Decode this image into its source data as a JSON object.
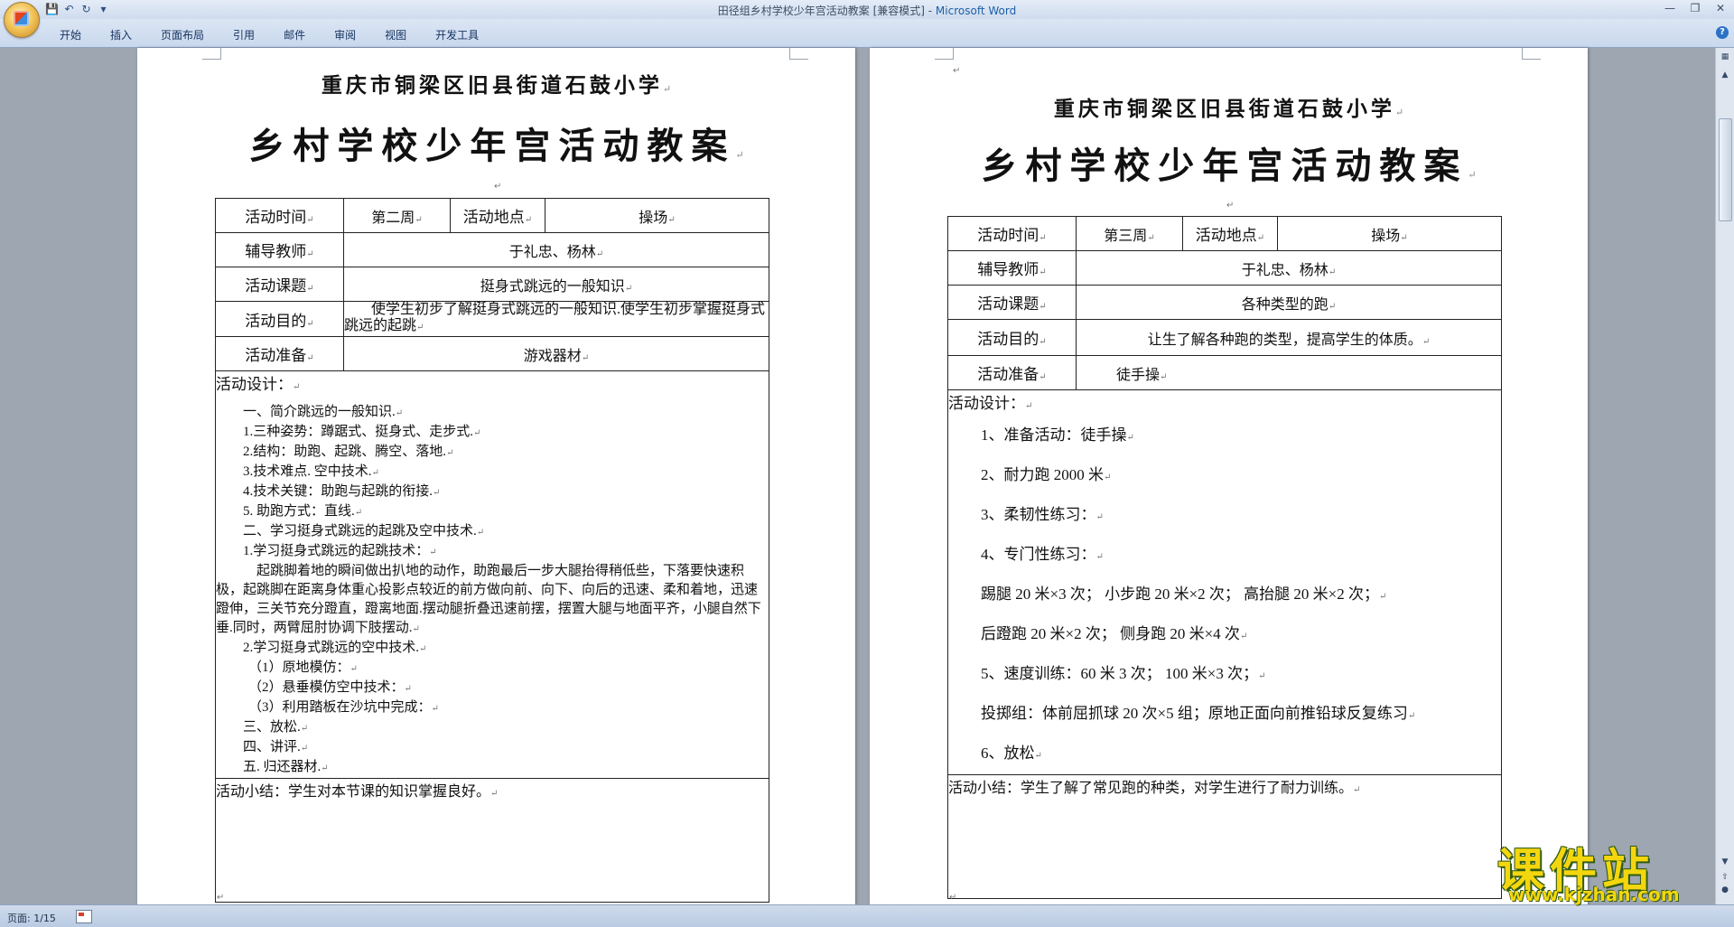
{
  "window": {
    "title_doc": "田径组乡村学校少年宫活动教案 [兼容模式] - ",
    "title_app": "Microsoft Word"
  },
  "ribbon": {
    "tabs": [
      "开始",
      "插入",
      "页面布局",
      "引用",
      "邮件",
      "审阅",
      "视图",
      "开发工具"
    ]
  },
  "status": {
    "page": "页面: 1/15"
  },
  "pages": [
    {
      "school": "重庆市铜梁区旧县街道石鼓小学",
      "title": "乡村学校少年宫活动教案",
      "labels": {
        "time": "活动时间",
        "place": "活动地点",
        "teacher": "辅导教师",
        "topic": "活动课题",
        "purpose": "活动目的",
        "prep": "活动准备",
        "design": "活动设计：",
        "summary_label": "活动小结："
      },
      "time": "第二周",
      "place": "操场",
      "teacher": "于礼忠、杨林",
      "topic": "挺身式跳远的一般知识",
      "purpose": "使学生初步了解挺身式跳远的一般知识.使学生初步掌握挺身式跳远的起跳",
      "prep": "游戏器材",
      "design_lines": [
        "一、简介跳远的一般知识.",
        "1.三种姿势：蹲踞式、挺身式、走步式.",
        "2.结构：助跑、起跳、腾空、落地.",
        "3.技术难点. 空中技术.",
        "4.技术关键：助跑与起跳的衔接.",
        "5. 助跑方式：直线.",
        "二、学习挺身式跳远的起跳及空中技术.",
        "1.学习挺身式跳远的起跳技术："
      ],
      "design_para": "起跳脚着地的瞬间做出扒地的动作，助跑最后一步大腿抬得稍低些，下落要快速积极，起跳脚在距离身体重心投影点较近的前方做向前、向下、向后的迅速、柔和着地，迅速蹬伸，三关节充分蹬直，蹬离地面.摆动腿折叠迅速前摆，摆置大腿与地面平齐，小腿自然下垂.同时，两臂屈肘协调下肢摆动.",
      "design_lines2": [
        "2.学习挺身式跳远的空中技术.",
        "（1）原地模仿：",
        "（2）悬垂模仿空中技术：",
        "（3）利用踏板在沙坑中完成：",
        "三、放松.",
        "四、讲评.",
        "五. 归还器材."
      ],
      "summary": "学生对本节课的知识掌握良好。"
    },
    {
      "school": "重庆市铜梁区旧县街道石鼓小学",
      "title": "乡村学校少年宫活动教案",
      "labels": {
        "time": "活动时间",
        "place": "活动地点",
        "teacher": "辅导教师",
        "topic": "活动课题",
        "purpose": "活动目的",
        "prep": "活动准备",
        "design": "活动设计：",
        "summary_label": "活动小结："
      },
      "time": "第三周",
      "place": "操场",
      "teacher": "于礼忠、杨林",
      "topic": "各种类型的跑",
      "purpose": "让生了解各种跑的类型，提高学生的体质。",
      "prep": "徒手操",
      "design_lines": [
        "1、准备活动：徒手操",
        "2、耐力跑 2000 米",
        "3、柔韧性练习：",
        "4、专门性练习：",
        "踢腿 20 米×3 次； 小步跑 20 米×2 次； 高抬腿 20 米×2 次；",
        "后蹬跑 20 米×2 次； 侧身跑 20 米×4 次",
        "5、速度训练：60 米 3 次； 100 米×3 次；",
        "投掷组：体前屈抓球 20 次×5 组；原地正面向前推铅球反复练习",
        "6、放松"
      ],
      "summary": "学生了解了常见跑的种类，对学生进行了耐力训练。"
    }
  ],
  "watermark": {
    "big": "课件站",
    "url": "www.kjzhan.com"
  }
}
